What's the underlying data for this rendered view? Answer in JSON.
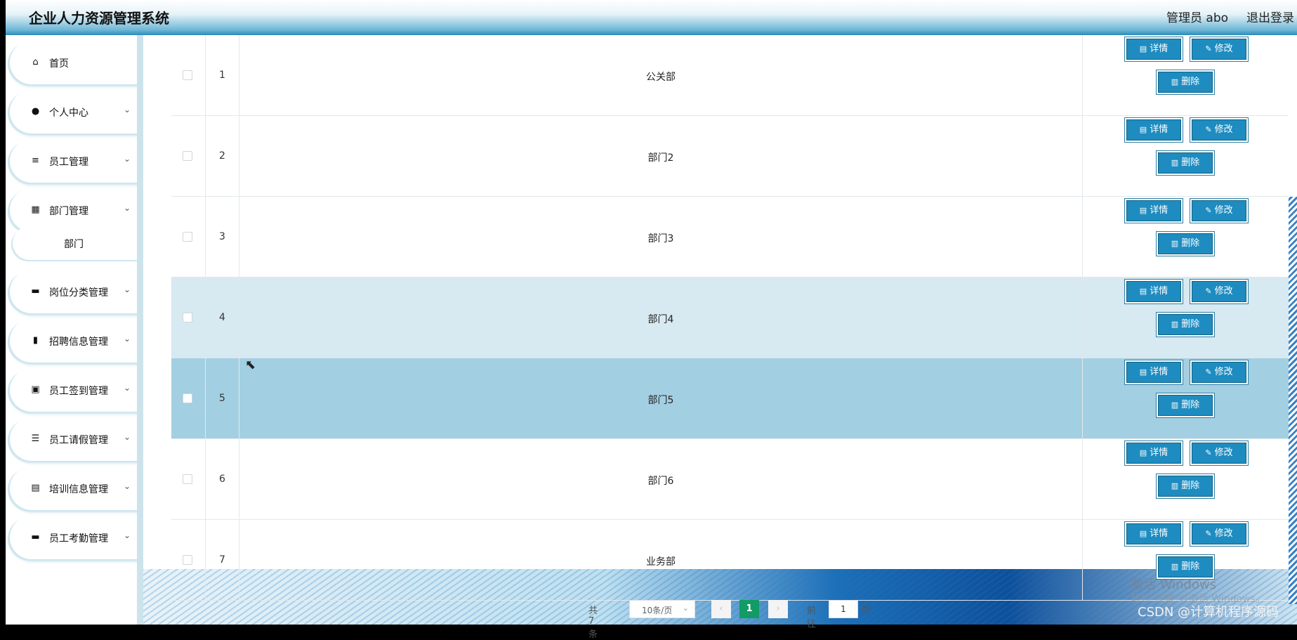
{
  "header": {
    "title": "企业人力资源管理系统",
    "admin": "管理员 abo",
    "logout": "退出登录"
  },
  "sidebar": {
    "items": [
      {
        "label": "首页",
        "icon": "home-icon",
        "glyph": "⌂"
      },
      {
        "label": "个人中心",
        "icon": "user-icon",
        "glyph": "●"
      },
      {
        "label": "员工管理",
        "icon": "sliders-icon",
        "glyph": "≡"
      },
      {
        "label": "部门管理",
        "icon": "grid-icon",
        "glyph": "▦"
      },
      {
        "label": "岗位分类管理",
        "icon": "ticket-icon",
        "glyph": "▬"
      },
      {
        "label": "招聘信息管理",
        "icon": "chart-icon",
        "glyph": "▮"
      },
      {
        "label": "员工签到管理",
        "icon": "clipboard-check-icon",
        "glyph": "▣"
      },
      {
        "label": "员工请假管理",
        "icon": "list-icon",
        "glyph": "☰"
      },
      {
        "label": "培训信息管理",
        "icon": "printer-icon",
        "glyph": "▤"
      },
      {
        "label": "员工考勤管理",
        "icon": "calendar-icon",
        "glyph": "▬"
      }
    ],
    "sub_item": "部门",
    "chevron": "⌄"
  },
  "table": {
    "rows": [
      {
        "index": "1",
        "name": "公关部"
      },
      {
        "index": "2",
        "name": "部门2"
      },
      {
        "index": "3",
        "name": "部门3"
      },
      {
        "index": "4",
        "name": "部门4"
      },
      {
        "index": "5",
        "name": "部门5"
      },
      {
        "index": "6",
        "name": "部门6"
      },
      {
        "index": "7",
        "name": "业务部"
      }
    ],
    "actions": {
      "detail": "详情",
      "edit": "修改",
      "delete": "删除"
    }
  },
  "pagination": {
    "total": "共 7 条",
    "page_size": "10条/页",
    "current_page": "1",
    "goto": "前往",
    "page_input": "1",
    "page_suffix": "页"
  },
  "overlay": {
    "watermark_title": "激活 Windows",
    "watermark_sub": "转到\"设置\"以激活 Windows。",
    "csdn": "CSDN @计算机程序源码"
  },
  "colors": {
    "button": "#1e8cc0",
    "pager_active": "#139b66",
    "row_highlight": "#d7e9f1",
    "row_hover": "#a3cfe2"
  }
}
